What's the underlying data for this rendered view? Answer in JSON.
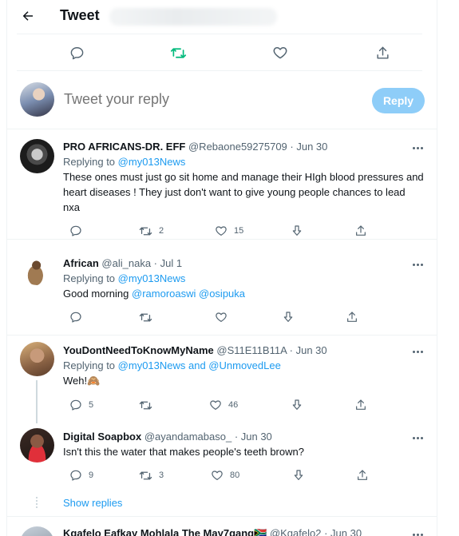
{
  "header": {
    "title": "Tweet"
  },
  "compose": {
    "placeholder": "Tweet your reply",
    "reply_label": "Reply"
  },
  "tweets": [
    {
      "name": "PRO AFRICANS-DR. EFF",
      "handle": "@Rebaone59275709",
      "time": "· Jun 30",
      "replying_prefix": "Replying to",
      "replying_to": "@my013News",
      "text": "These ones must just go sit home and manage their HIgh blood pressures and heart diseases ! They just don't want to give young people chances to lead nxa",
      "replies": "",
      "retweets": "2",
      "likes": "15"
    },
    {
      "name": "African",
      "handle": "@ali_naka",
      "time": "· Jul 1",
      "replying_prefix": "Replying to",
      "replying_to": "@my013News",
      "text_prefix": "Good morning",
      "mentions": "@ramoroaswi @osipuka",
      "replies": "",
      "retweets": "",
      "likes": ""
    },
    {
      "name": "YouDontNeedToKnowMyName",
      "handle": "@S11E11B11A",
      "time": "· Jun 30",
      "replying_prefix": "Replying to",
      "replying_to": "@my013News and @UnmovedLee",
      "text": "Weh!🙈",
      "replies": "5",
      "retweets": "",
      "likes": "46"
    },
    {
      "name": "Digital Soapbox",
      "handle": "@ayandamabaso_",
      "time": "· Jun 30",
      "text": "Isn't this the water that makes people's teeth brown?",
      "replies": "9",
      "retweets": "3",
      "likes": "80"
    },
    {
      "name": "Kgafelo Eafkay Mohlala The May7gang🇿🇦",
      "handle": "@Kgafelo2",
      "time": "· Jun 30"
    }
  ],
  "show_replies": "Show replies",
  "colors": {
    "accent": "#1d9bf0",
    "retweet_active": "#00ba7c",
    "muted": "#536471",
    "reply_button": "#8ecdf8"
  }
}
